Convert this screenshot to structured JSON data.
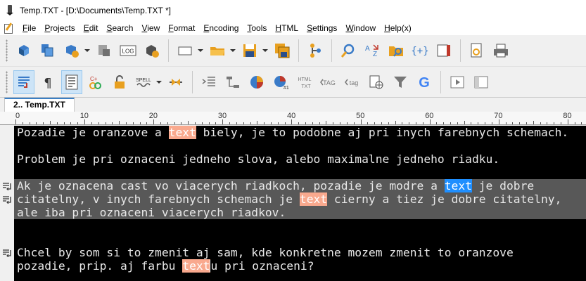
{
  "window": {
    "title": "Temp.TXT - [D:\\Documents\\Temp.TXT *]"
  },
  "menubar": {
    "items": [
      "File",
      "Projects",
      "Edit",
      "Search",
      "View",
      "Format",
      "Encoding",
      "Tools",
      "HTML",
      "Settings",
      "Window",
      "Help(x)"
    ]
  },
  "toolbar1": {
    "icons": [
      "new-3d-cube-icon",
      "open-multiple-icon",
      "project-icon",
      "print-preview-icon",
      "log-icon",
      "settings-cube-icon",
      "new-doc-icon",
      "open-folder-icon",
      "save-icon",
      "save-all-icon",
      "tree-icon",
      "find-icon",
      "replace-icon",
      "find-in-files-icon",
      "brackets-icon",
      "bookmarks-icon",
      "document-icon",
      "printer-icon"
    ],
    "log_label": "LOG"
  },
  "toolbar2": {
    "icons": [
      "word-wrap-icon",
      "paragraph-icon",
      "outline-icon",
      "syntax-icon",
      "lock-icon",
      "spell-icon",
      "split-icon",
      "indent-icon",
      "tree-icon",
      "pie-icon",
      "pie-number-icon",
      "html-txt-icon",
      "tag-remove-icon",
      "tag-icon",
      "browser-icon",
      "filter-icon",
      "google-icon",
      "play-icon",
      "sidebar-icon"
    ],
    "spell_label": "SPELL",
    "html_label": "HTML",
    "txt_label": "TXT",
    "tag_label": "TAG",
    "tag2_label": "tag",
    "paragraph_symbol": "¶",
    "google_label": "G"
  },
  "tab": {
    "label": "2.. Temp.TXT"
  },
  "ruler": {
    "labels": [
      "0",
      "10",
      "20",
      "30",
      "40",
      "50",
      "60",
      "70",
      "80"
    ]
  },
  "editor": {
    "colors": {
      "background": "#000000",
      "text": "#e8e8e8",
      "selection": "#585858",
      "highlight_orange": "#f9a98e",
      "highlight_blue": "#1f8fff"
    },
    "lines": [
      {
        "parts": [
          [
            "Pozadie je oranzove a ",
            ""
          ],
          [
            "text",
            "orange"
          ],
          [
            " biely, je to podobne aj pri inych farebnych schemach.",
            ""
          ]
        ],
        "wrap": false
      },
      {
        "parts": [
          [
            "",
            ""
          ]
        ],
        "wrap": false
      },
      {
        "parts": [
          [
            "Problem je pri oznaceni jedneho slova, alebo maximalne jedneho riadku.",
            ""
          ]
        ],
        "wrap": false
      },
      {
        "parts": [
          [
            "",
            ""
          ]
        ],
        "wrap": false
      },
      {
        "parts": [
          [
            "Ak je oznacena cast vo viacerych riadkoch, pozadie je modre a ",
            ""
          ],
          [
            "text",
            "blue"
          ],
          [
            " je dobre",
            ""
          ]
        ],
        "wrap": true
      },
      {
        "parts": [
          [
            "citatelny, v inych farebnych schemach je ",
            ""
          ],
          [
            "text",
            "orange"
          ],
          [
            " cierny a tiez je dobre citatelny,",
            ""
          ]
        ],
        "wrap": true
      },
      {
        "parts": [
          [
            "ale iba pri oznaceni viacerych riadkov.",
            ""
          ]
        ],
        "wrap": false
      },
      {
        "parts": [
          [
            "",
            ""
          ]
        ],
        "wrap": false
      },
      {
        "parts": [
          [
            "",
            ""
          ]
        ],
        "wrap": false
      },
      {
        "parts": [
          [
            "Chcel by som si to zmenit aj sam, kde konkretne mozem zmenit to oranzove",
            ""
          ]
        ],
        "wrap": true
      },
      {
        "parts": [
          [
            "pozadie, prip. aj farbu ",
            ""
          ],
          [
            "text",
            "orange-cursor"
          ],
          [
            "u pri oznaceni?",
            ""
          ]
        ],
        "wrap": false
      }
    ]
  }
}
